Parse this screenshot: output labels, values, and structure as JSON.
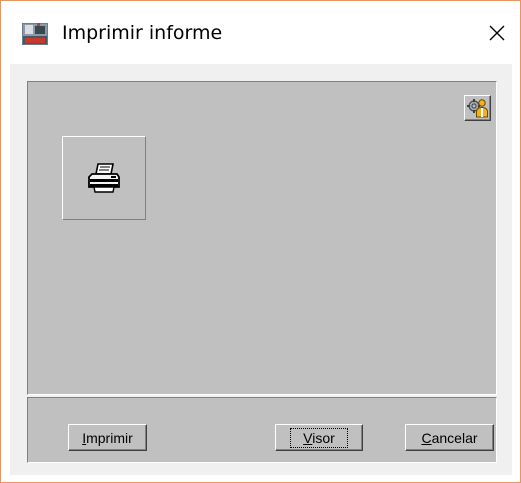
{
  "window": {
    "title": "Imprimir informe",
    "app_icon": "nxp-report-icon",
    "close_icon": "close-icon"
  },
  "panel": {
    "config_icon": "user-gear-icon",
    "printer_icon": "printer-icon"
  },
  "buttons": {
    "imprimir": {
      "mnemonic": "I",
      "rest": "mprimir"
    },
    "visor": {
      "mnemonic": "V",
      "rest": "isor"
    },
    "cancelar": {
      "mnemonic": "C",
      "rest": "ancelar"
    }
  },
  "colors": {
    "window_border": "#e8955f",
    "panel_bg": "#c0c0c0",
    "client_bg": "#f0f0f0"
  }
}
